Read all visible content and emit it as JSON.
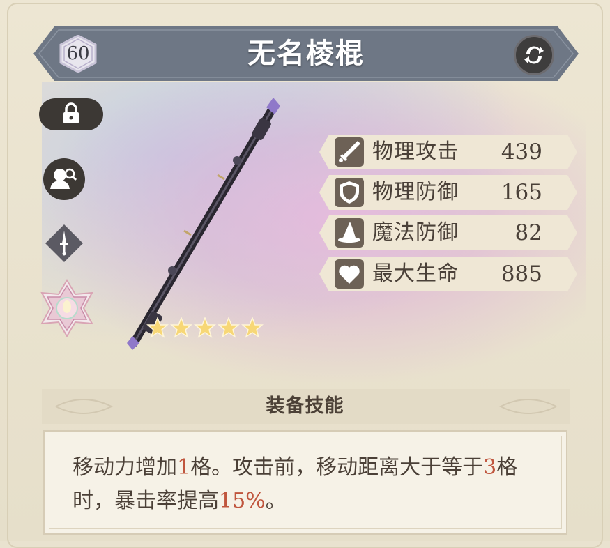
{
  "item": {
    "name": "无名棱棍",
    "level": "60",
    "rarity_stars": 5
  },
  "stats": [
    {
      "icon": "sword-icon",
      "label": "物理攻击",
      "value": "439"
    },
    {
      "icon": "shield-icon",
      "label": "物理防御",
      "value": "165"
    },
    {
      "icon": "wizard-hat-icon",
      "label": "魔法防御",
      "value": "82"
    },
    {
      "icon": "heart-icon",
      "label": "最大生命",
      "value": "885"
    }
  ],
  "skill": {
    "title": "装备技能",
    "text_parts": [
      "移动力增加",
      "1",
      "格。攻击前，移动距离大于等于",
      "3",
      "格时，暴击率提高",
      "15%",
      "。"
    ]
  },
  "colors": {
    "title_bar": "#6f7a88",
    "highlight": "#c0563e",
    "text": "#4a4038",
    "stat_bg": "#efe7d6"
  }
}
